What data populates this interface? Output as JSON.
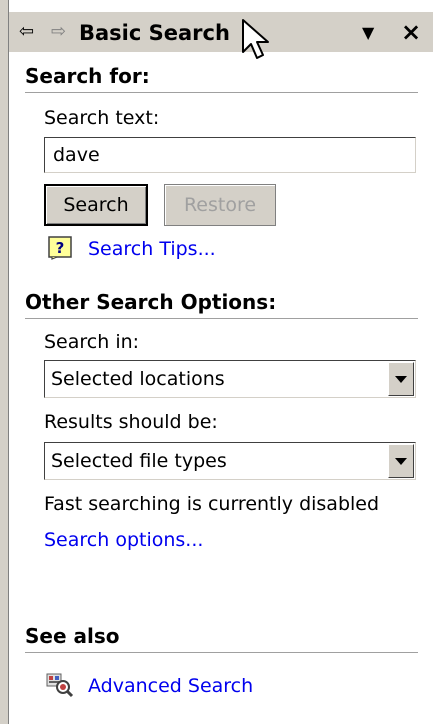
{
  "titlebar": {
    "title": "Basic Search",
    "back_icon": "back-arrow-icon",
    "forward_icon": "forward-arrow-icon",
    "dropdown_icon": "chevron-down-icon",
    "close_icon": "close-icon"
  },
  "search_for": {
    "heading": "Search for:",
    "search_text_label": "Search text:",
    "search_text_value": "dave",
    "search_button": "Search",
    "restore_button": "Restore",
    "tips_link": "Search Tips..."
  },
  "other_options": {
    "heading": "Other Search Options:",
    "search_in_label": "Search in:",
    "search_in_value": "Selected locations",
    "results_label": "Results should be:",
    "results_value": "Selected file types",
    "status_text": "Fast searching is currently disabled",
    "options_link": "Search options..."
  },
  "see_also": {
    "heading": "See also",
    "advanced_link": "Advanced Search"
  },
  "colors": {
    "panel_gray": "#d4d0c8",
    "link_blue": "#0000ee",
    "disabled_text": "#a0a0a0"
  }
}
